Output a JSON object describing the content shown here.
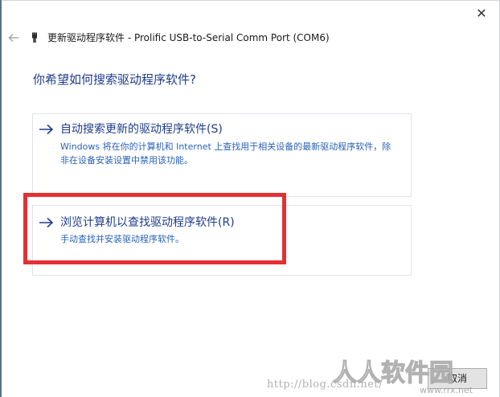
{
  "window": {
    "close_glyph": "✕",
    "title": "更新驱动程序软件 - Prolific USB-to-Serial Comm Port (COM6)"
  },
  "heading": "你希望如何搜索驱动程序软件?",
  "options": [
    {
      "title": "自动搜索更新的驱动程序软件(S)",
      "description": "Windows 将在你的计算机和 Internet 上查找用于相关设备的最新驱动程序软件，除非在设备安装设置中禁用该功能。",
      "icon": "arrow-right-icon"
    },
    {
      "title": "浏览计算机以查找驱动程序软件(R)",
      "description": "手动查找并安装驱动程序软件。",
      "icon": "arrow-right-icon"
    }
  ],
  "buttons": {
    "cancel": "取消"
  },
  "watermark": {
    "url": "http://blog.csdn.net/",
    "logo_text": "人人软件园",
    "logo_url": "www.rrx.net"
  },
  "icons": {
    "back": "back-arrow-icon",
    "device": "usb-device-icon",
    "close": "close-icon"
  },
  "colors": {
    "heading": "#1e3d8c",
    "description": "#2a62b8",
    "highlight": "#e43033",
    "option_border": "#dfe4ea"
  }
}
